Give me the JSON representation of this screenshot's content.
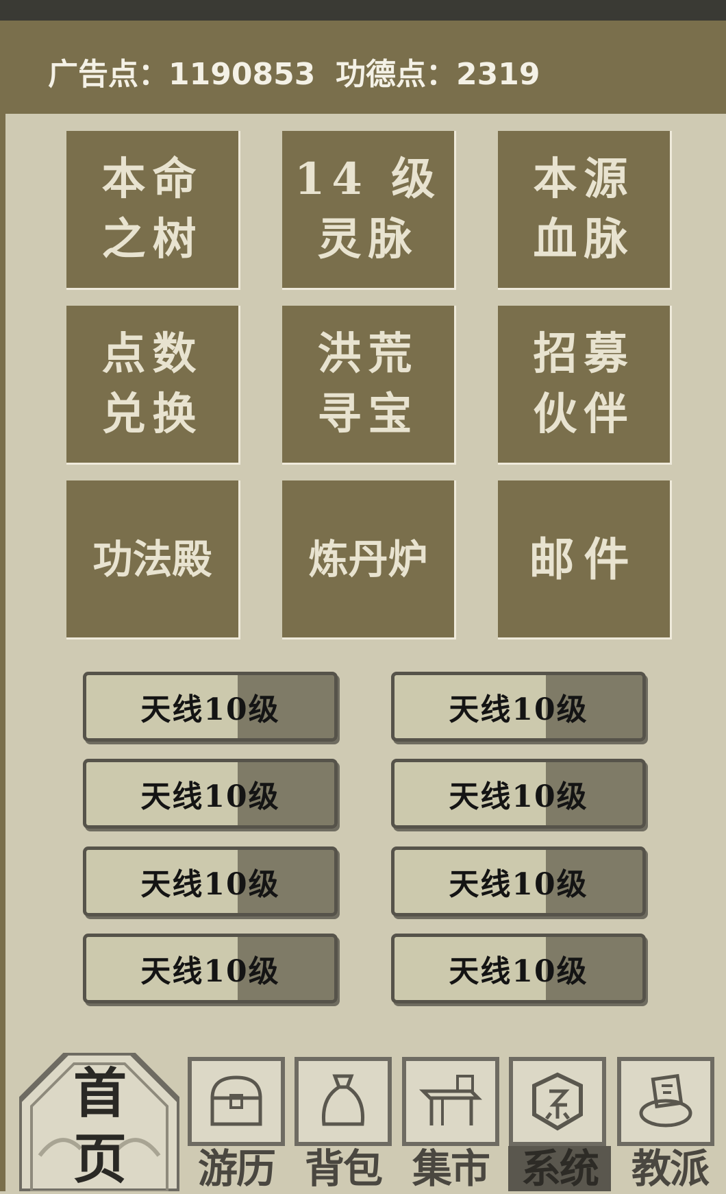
{
  "header": {
    "ad_points_label": "广告点：1190853",
    "merit_points_label": "功德点：2319"
  },
  "tiles": [
    {
      "line1": "本命",
      "line2": "之树"
    },
    {
      "line1": "14 级",
      "line2": "灵脉"
    },
    {
      "line1": "本源",
      "line2": "血脉"
    },
    {
      "line1": "点数",
      "line2": "兑换"
    },
    {
      "line1": "洪荒",
      "line2": "寻宝"
    },
    {
      "line1": "招募",
      "line2": "伙伴"
    },
    {
      "line1": "功法殿"
    },
    {
      "line1": "炼丹炉"
    },
    {
      "line1": "邮件"
    }
  ],
  "upgrades": [
    "天线10级",
    "天线10级",
    "天线10级",
    "天线10级",
    "天线10级",
    "天线10级",
    "天线10级",
    "天线10级"
  ],
  "bottom_nav": {
    "home": "首页",
    "items": [
      {
        "label": "游历",
        "icon": "chest-icon"
      },
      {
        "label": "背包",
        "icon": "bag-icon"
      },
      {
        "label": "集市",
        "icon": "market-stall-icon"
      },
      {
        "label": "系统",
        "icon": "system-seal-icon",
        "active": true
      },
      {
        "label": "教派",
        "icon": "sect-scroll-icon"
      }
    ]
  }
}
